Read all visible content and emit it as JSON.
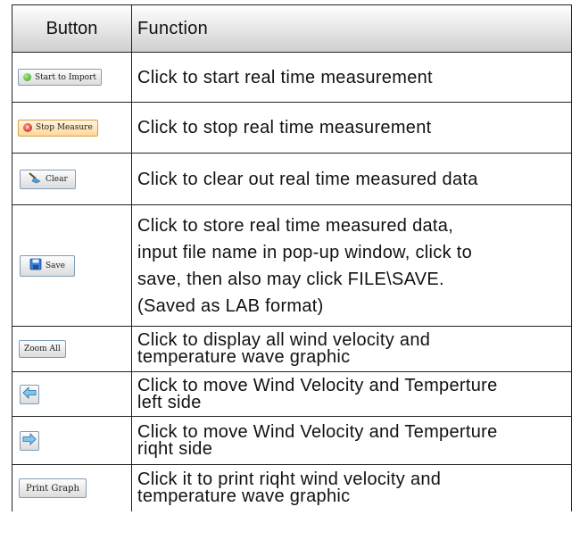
{
  "header": {
    "col1": "Button",
    "col2": "Function"
  },
  "rows": [
    {
      "button_label": "Start to Import",
      "icon": "green-dot-icon",
      "function": "Click to start real time measurement"
    },
    {
      "button_label": "Stop Measure",
      "icon": "red-x-icon",
      "function": "Click to stop real time measurement"
    },
    {
      "button_label": "Clear",
      "icon": "broom-icon",
      "function": "Click to clear out real time measured data"
    },
    {
      "button_label": "Save",
      "icon": "floppy-disk-icon",
      "function": "Click to store real time measured data,\ninput file name in pop-up window, click to\nsave, then also may click FILE\\SAVE.\n(Saved as LAB format)"
    },
    {
      "button_label": "Zoom All",
      "icon": "",
      "function": "Click to display all wind velocity and\ntemperature wave graphic"
    },
    {
      "button_label": "",
      "icon": "left-arrow-icon",
      "function": "Click to move Wind Velocity and Temperture\n left side"
    },
    {
      "button_label": "",
      "icon": "right-arrow-icon",
      "function": "Click to move Wind Velocity and Temperture\n riqht side"
    },
    {
      "button_label": "Print Graph",
      "icon": "",
      "function": "Click it to print riqht wind velocity and\ntemperature wave graphic"
    }
  ]
}
